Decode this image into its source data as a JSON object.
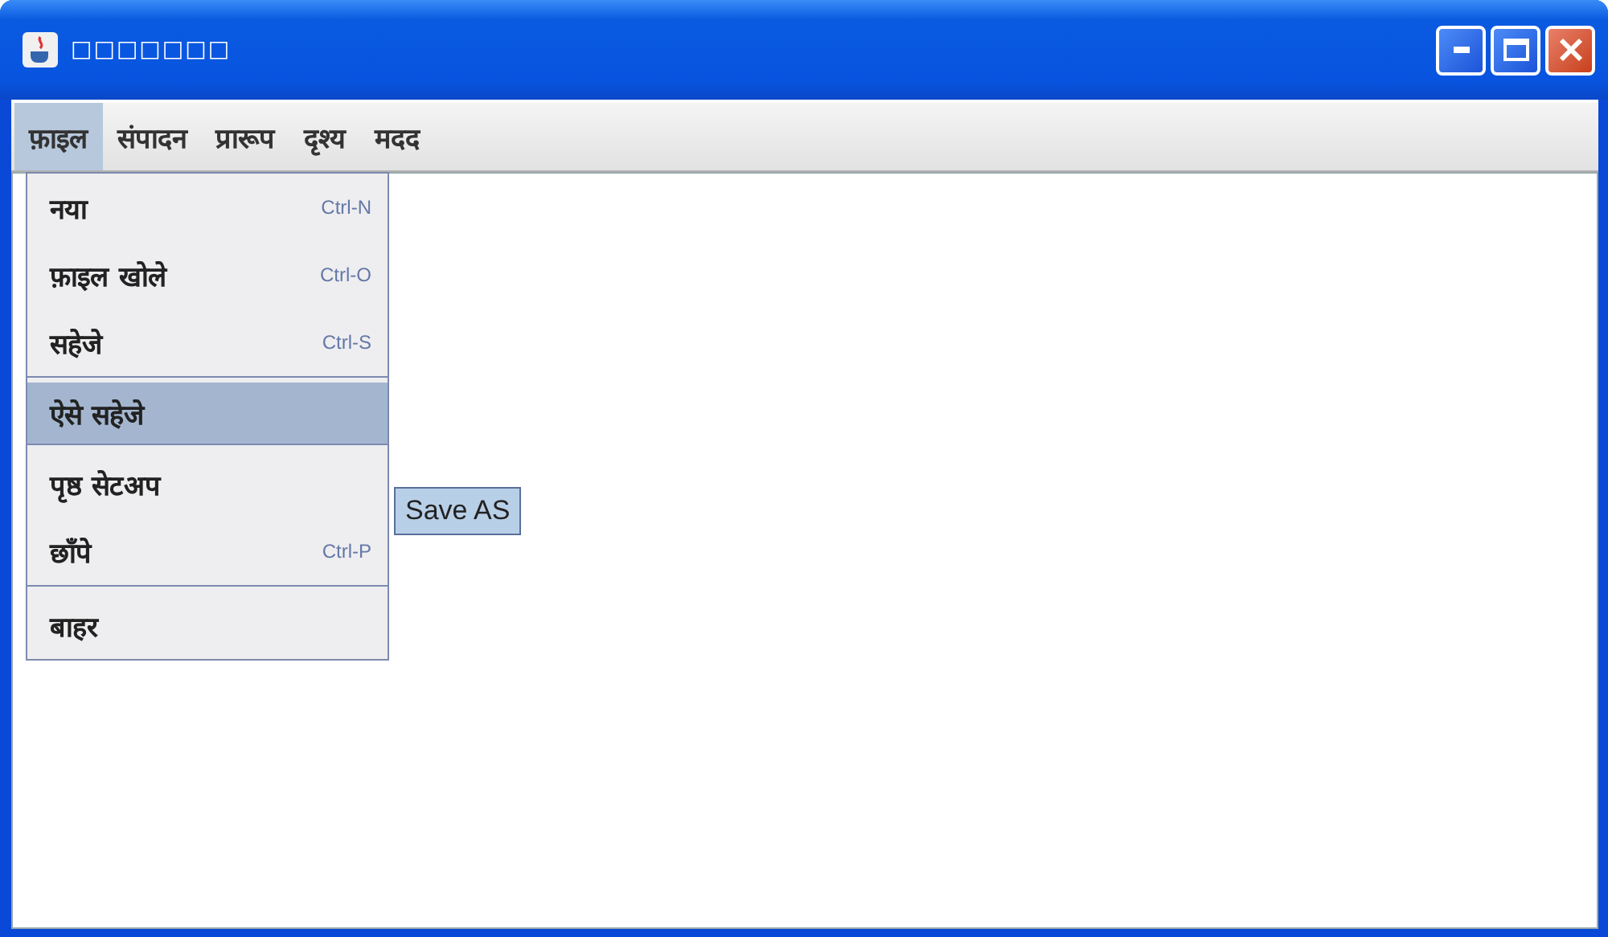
{
  "window": {
    "title": "□□□□□□□"
  },
  "menubar": [
    {
      "label": "फ़ाइल",
      "selected": true
    },
    {
      "label": "संपादन",
      "selected": false
    },
    {
      "label": "प्रारूप",
      "selected": false
    },
    {
      "label": "दृश्य",
      "selected": false
    },
    {
      "label": "मदद",
      "selected": false
    }
  ],
  "menu": [
    {
      "kind": "item",
      "label": "नया",
      "shortcut": "Ctrl-N",
      "selected": false
    },
    {
      "kind": "item",
      "label": "फ़ाइल खोले",
      "shortcut": "Ctrl-O",
      "selected": false
    },
    {
      "kind": "item",
      "label": "सहेजे",
      "shortcut": "Ctrl-S",
      "selected": false
    },
    {
      "kind": "separator"
    },
    {
      "kind": "item",
      "label": "ऐसे सहेजे",
      "selected": true
    },
    {
      "kind": "separator"
    },
    {
      "kind": "item",
      "label": "पृष्ठ सेटअप",
      "selected": false
    },
    {
      "kind": "item",
      "label": "छाँपे",
      "shortcut": "Ctrl-P",
      "selected": false
    },
    {
      "kind": "separator"
    },
    {
      "kind": "item",
      "label": "बाहर",
      "selected": false
    }
  ],
  "tooltip": "Save AS"
}
